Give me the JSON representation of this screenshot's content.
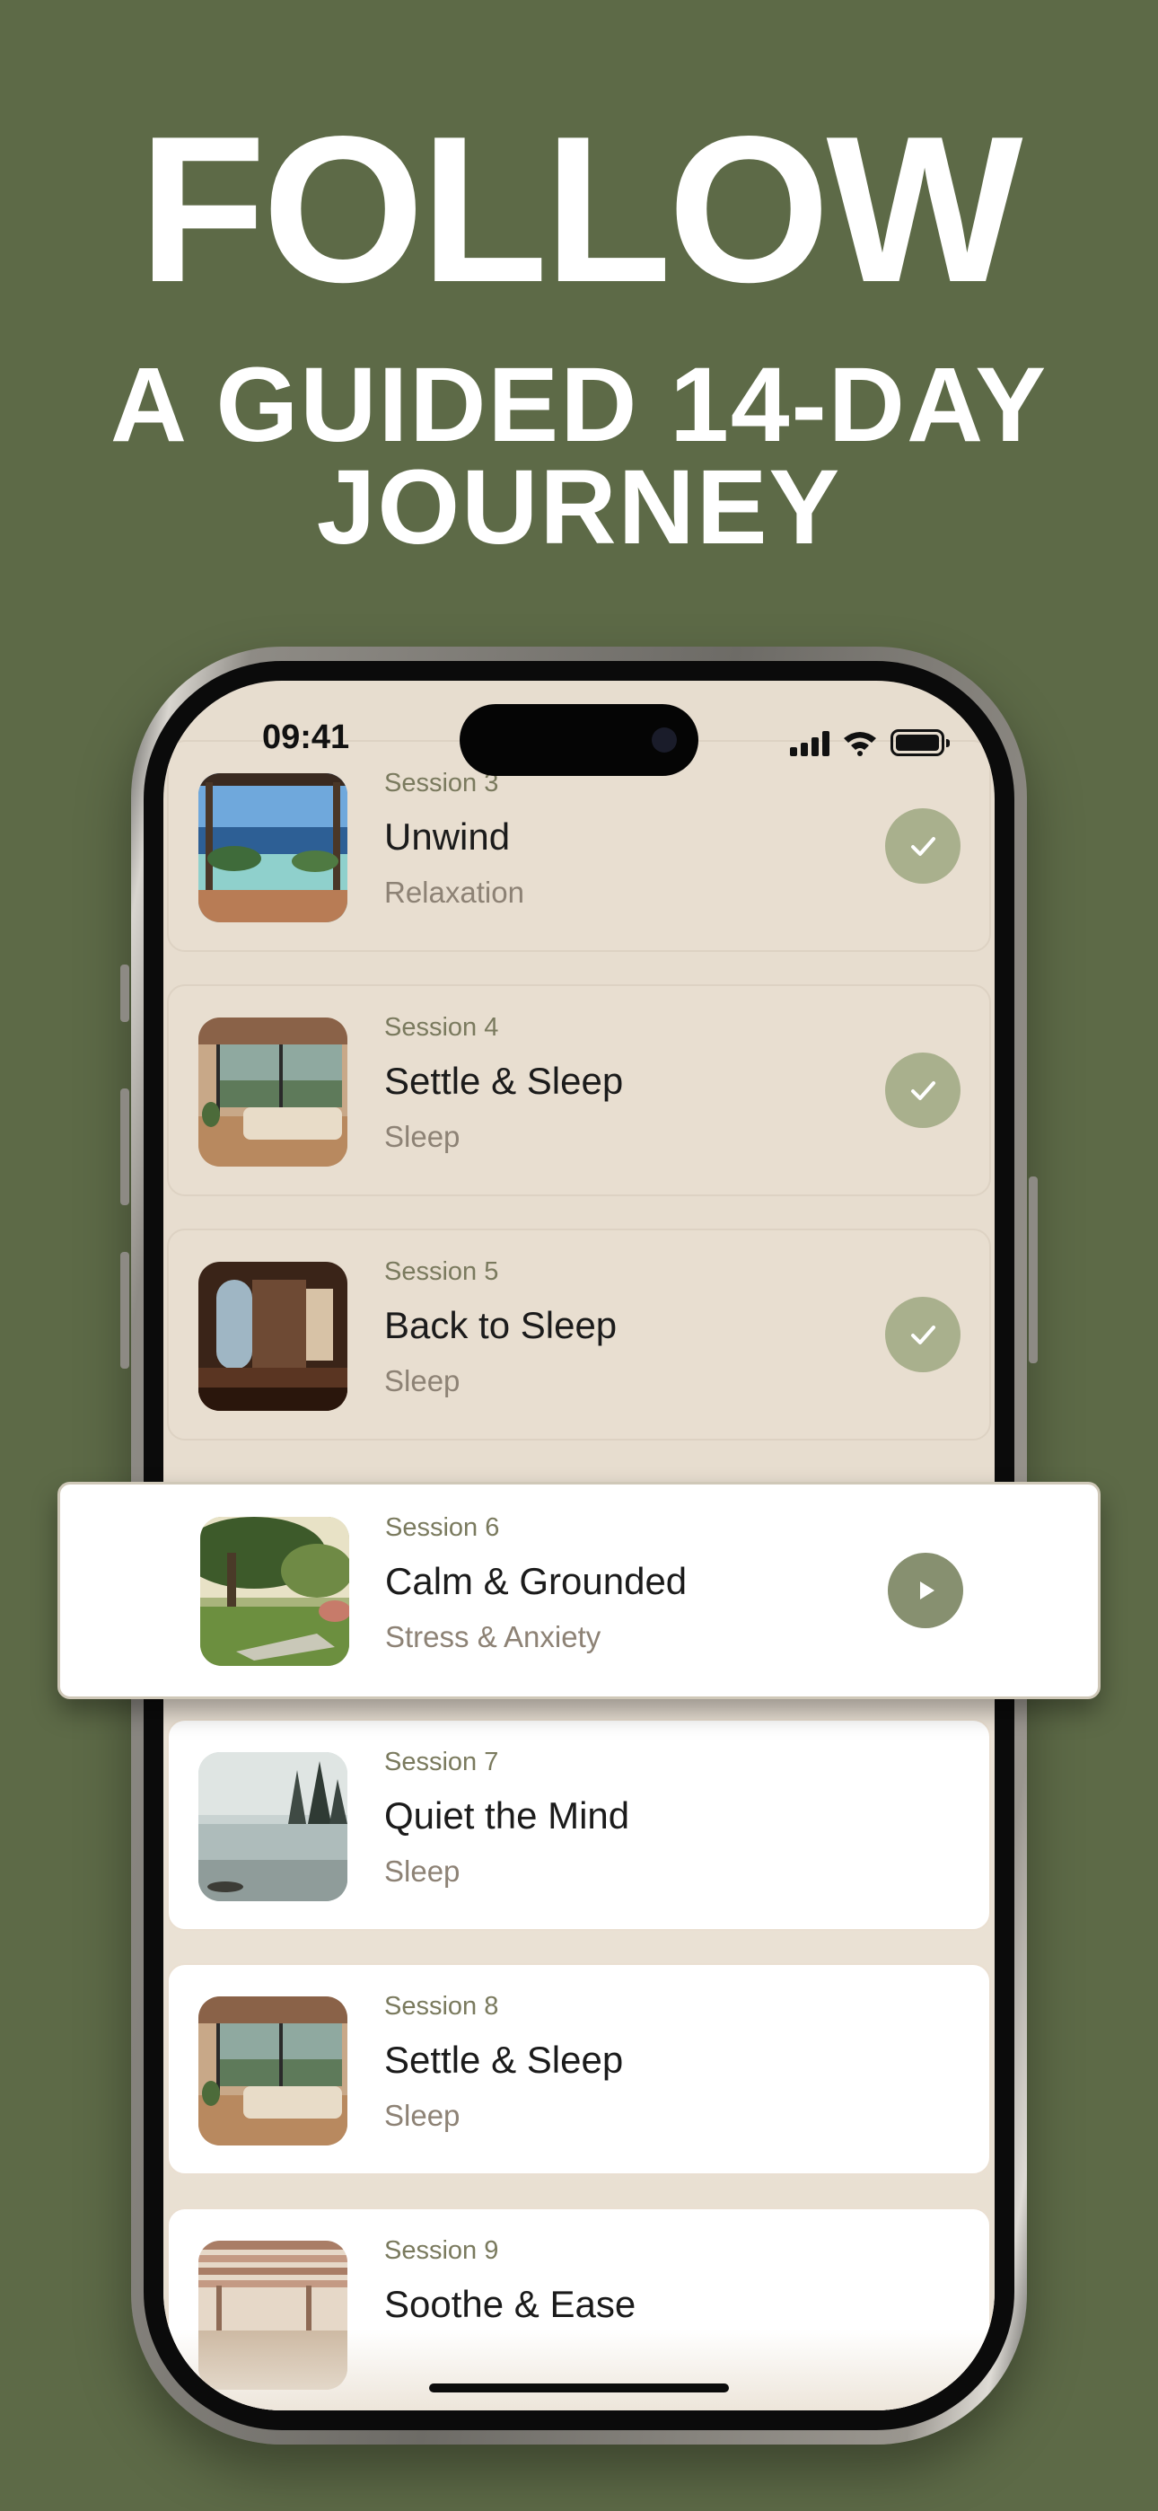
{
  "headline": {
    "line1": "FOLLOW",
    "line2": "A GUIDED 14-DAY",
    "line3": "JOURNEY"
  },
  "status_bar": {
    "time": "09:41",
    "icons": [
      "signal-icon",
      "wifi-icon",
      "battery-icon"
    ]
  },
  "sessions": [
    {
      "number": "Session 3",
      "title": "Unwind",
      "category": "Relaxation",
      "status": "completed",
      "image": "ocean-terrace-image"
    },
    {
      "number": "Session 4",
      "title": "Settle & Sleep",
      "category": "Sleep",
      "status": "completed",
      "image": "lakeside-bedroom-image"
    },
    {
      "number": "Session 5",
      "title": "Back to Sleep",
      "category": "Sleep",
      "status": "completed",
      "image": "dim-room-image"
    },
    {
      "number": "Session 6",
      "title": "Calm & Grounded",
      "category": "Stress & Anxiety",
      "status": "current",
      "image": "garden-oak-image"
    },
    {
      "number": "Session 7",
      "title": "Quiet the Mind",
      "category": "Sleep",
      "status": "upcoming",
      "image": "misty-lake-image"
    },
    {
      "number": "Session 8",
      "title": "Settle & Sleep",
      "category": "Sleep",
      "status": "upcoming",
      "image": "lakeside-bedroom-image"
    },
    {
      "number": "Session 9",
      "title": "Soothe & Ease",
      "category": "",
      "status": "upcoming",
      "image": "pergola-image"
    }
  ],
  "colors": {
    "background": "#5d6a47",
    "screen": "#e7ddcf",
    "check_button": "#a9b08d",
    "play_button": "#879070"
  }
}
